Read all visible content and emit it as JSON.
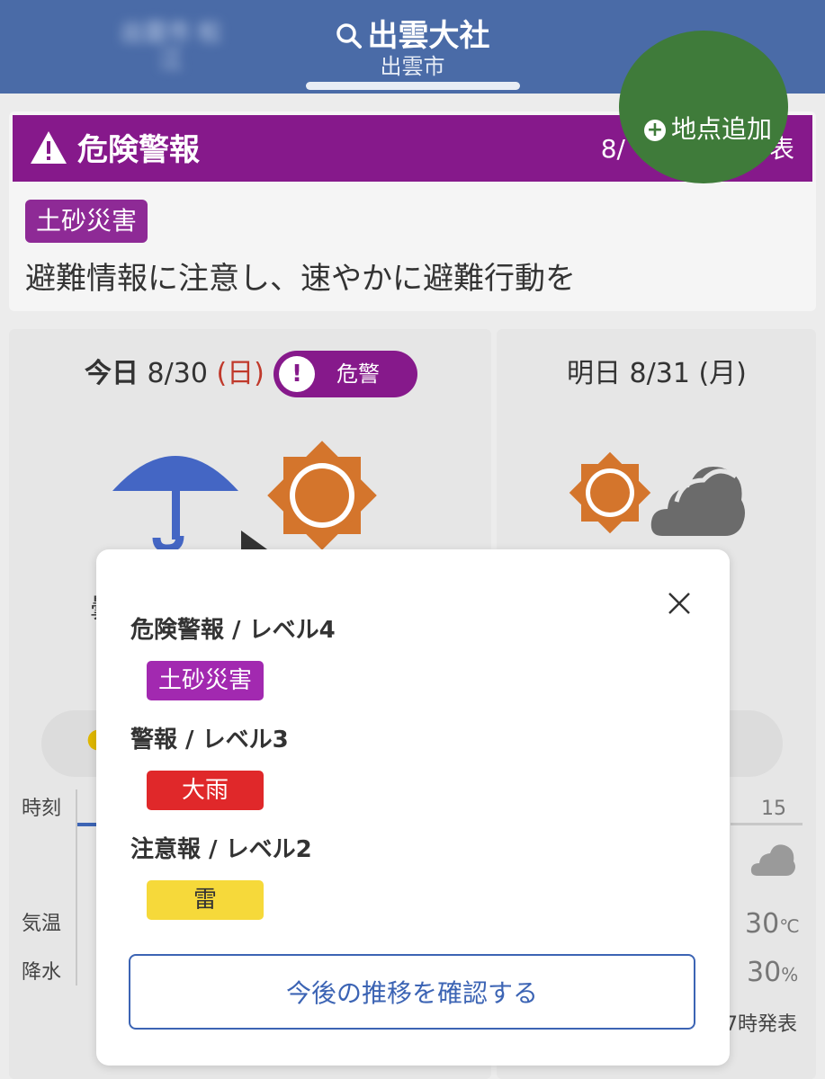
{
  "header": {
    "title": "出雲大社",
    "subtitle": "出雲市",
    "left_blurred": "出雲市 松江"
  },
  "warning_card": {
    "title": "危険警報",
    "time_fragment": "8/",
    "time_fragment_end": "表",
    "tag": "土砂災害",
    "message": "避難情報に注意し、速やかに避難行動を"
  },
  "fab": {
    "label": "地点追加"
  },
  "today": {
    "label_bold": "今日",
    "date": "8/30",
    "weekday": "(日)",
    "alert_pill": "危警",
    "initial_partial": "曇"
  },
  "tomorrow": {
    "label": "明日",
    "date": "8/31",
    "weekday": "(月)"
  },
  "table": {
    "row_time": "時刻",
    "row_temp": "気温",
    "row_precip": "降水",
    "hour_right": "15",
    "temp_value": "30",
    "temp_unit": "℃",
    "precip_value": "30",
    "precip_unit": "%",
    "issued": "7時発表"
  },
  "modal": {
    "level4_heading": "危険警報 / レベル4",
    "level4_tag": "土砂災害",
    "level3_heading": "警報 / レベル3",
    "level3_tag": "大雨",
    "level2_heading": "注意報 / レベル2",
    "level2_tag": "雷",
    "trend_button": "今後の推移を確認する"
  },
  "colors": {
    "header": "#4a6ba7",
    "danger_purple": "#86198b",
    "warning_red": "#e0282a",
    "advisory_yellow": "#f6d93a",
    "fab_green": "#3f7b3a",
    "accent_blue": "#3c64b4"
  },
  "icons": [
    "search-icon",
    "warning-triangle-icon",
    "plus-circle-icon",
    "exclamation-icon",
    "umbrella-icon",
    "sun-icon",
    "cloud-icon",
    "close-icon"
  ]
}
